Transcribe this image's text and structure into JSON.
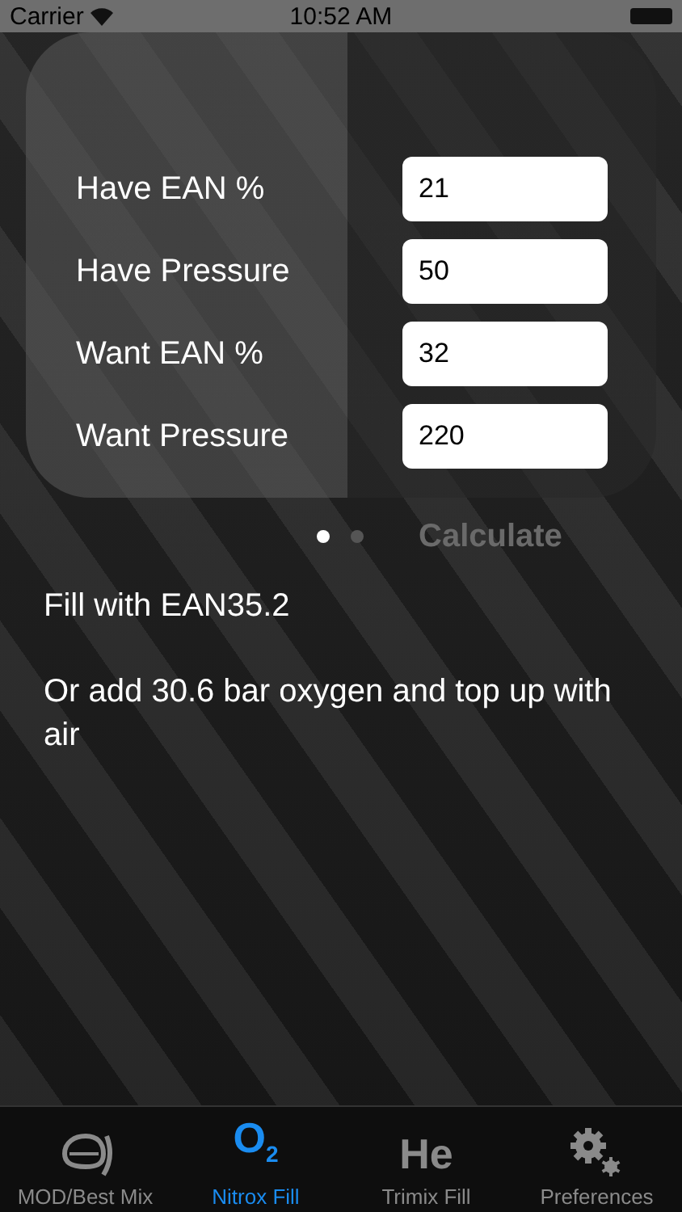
{
  "status_bar": {
    "carrier": "Carrier",
    "time": "10:52 AM"
  },
  "fields": [
    {
      "label": "Have EAN %",
      "value": "21"
    },
    {
      "label": "Have Pressure",
      "value": "50"
    },
    {
      "label": "Want EAN %",
      "value": "32"
    },
    {
      "label": "Want Pressure",
      "value": "220"
    }
  ],
  "pager": [
    {
      "selected": true
    },
    {
      "selected": false
    }
  ],
  "calculate_button": {
    "label": "Calculate",
    "disabled": true
  },
  "results": [
    "Fill with EAN35.2",
    "Or add 30.6 bar oxygen and top up with air"
  ],
  "tab_bar": [
    {
      "kind": "mask",
      "label": "MOD/Best Mix",
      "selected": false
    },
    {
      "kind": "glyph",
      "glyph": "O$_{2}$",
      "label": "Nitrox Fill",
      "selected": true
    },
    {
      "kind": "glyph",
      "glyph": "He",
      "label": "Trimix Fill",
      "selected": false
    },
    {
      "kind": "gears",
      "label": "Preferences",
      "selected": false
    }
  ]
}
